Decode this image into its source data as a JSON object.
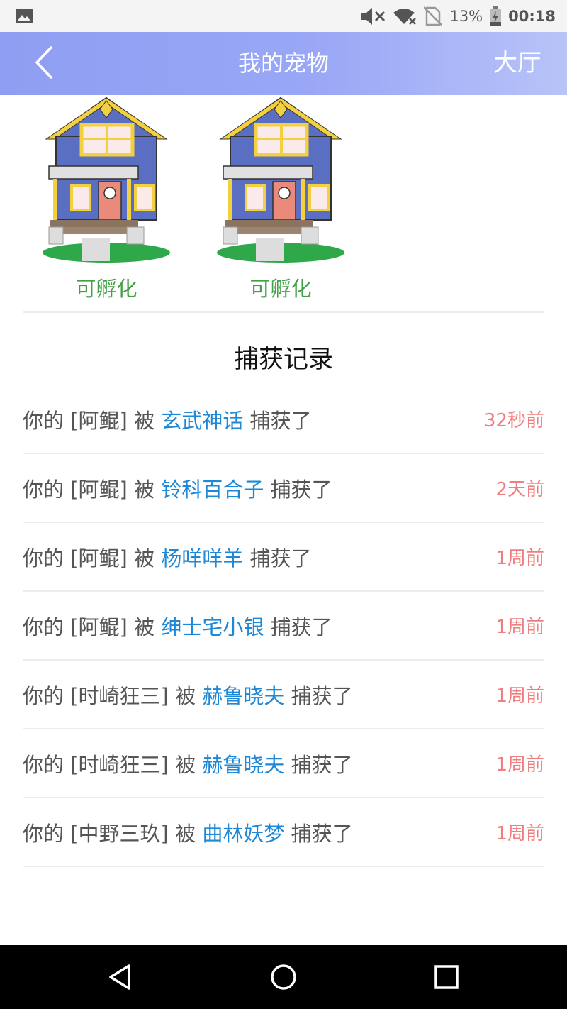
{
  "statusbar": {
    "icons": [
      "gallery-icon",
      "volume-mute-icon",
      "wifi-off-icon",
      "no-sim-icon",
      "battery-icon"
    ],
    "battery": "13%",
    "time": "00:18"
  },
  "header": {
    "title": "我的宠物",
    "right_label": "大厅",
    "gradient": [
      "#8f9ef2",
      "#b8c3f8"
    ]
  },
  "pets": [
    {
      "status": "可孵化",
      "icon": "house-icon"
    },
    {
      "status": "可孵化",
      "icon": "house-icon"
    }
  ],
  "capture": {
    "title": "捕获记录",
    "records": [
      {
        "prefix": "你的",
        "pet": "[阿鲲]",
        "by": "被",
        "user": "玄武神话",
        "action": "捕获了",
        "time": "32秒前"
      },
      {
        "prefix": "你的",
        "pet": "[阿鲲]",
        "by": "被",
        "user": "铃科百合子",
        "action": "捕获了",
        "time": "2天前"
      },
      {
        "prefix": "你的",
        "pet": "[阿鲲]",
        "by": "被",
        "user": "杨咩咩羊",
        "action": "捕获了",
        "time": "1周前"
      },
      {
        "prefix": "你的",
        "pet": "[阿鲲]",
        "by": "被",
        "user": "绅士宅小银",
        "action": "捕获了",
        "time": "1周前"
      },
      {
        "prefix": "你的",
        "pet": "[时崎狂三]",
        "by": "被",
        "user": "赫鲁晓夫",
        "action": "捕获了",
        "time": "1周前"
      },
      {
        "prefix": "你的",
        "pet": "[时崎狂三]",
        "by": "被",
        "user": "赫鲁晓夫",
        "action": "捕获了",
        "time": "1周前"
      },
      {
        "prefix": "你的",
        "pet": "[中野三玖]",
        "by": "被",
        "user": "曲林妖梦",
        "action": "捕获了",
        "time": "1周前"
      }
    ],
    "colors": {
      "user": "#1e88d6",
      "time": "#ef7e80"
    }
  },
  "navbar": {
    "icons": [
      "back-triangle-icon",
      "home-circle-icon",
      "recents-square-icon"
    ]
  }
}
